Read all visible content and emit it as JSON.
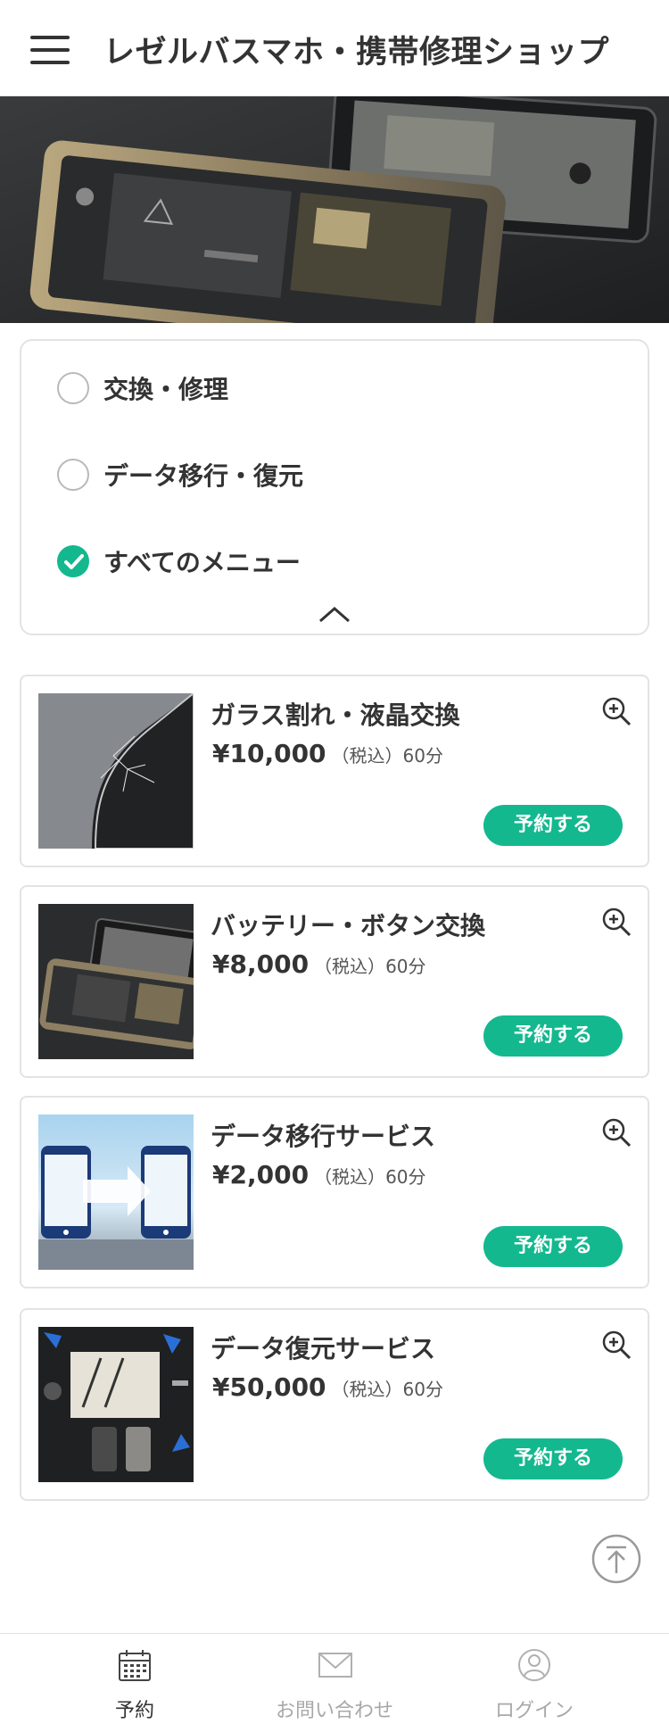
{
  "header": {
    "title": "レゼルバスマホ・携帯修理ショップ",
    "menu_icon": "hamburger-menu-icon"
  },
  "hero": {
    "image": "disassembled-smartphones-photo"
  },
  "filter": {
    "options": [
      {
        "label": "交換・修理",
        "checked": false
      },
      {
        "label": "データ移行・復元",
        "checked": false
      },
      {
        "label": "すべてのメニュー",
        "checked": true
      }
    ],
    "collapse_icon": "chevron-up-icon"
  },
  "menu_items": [
    {
      "title": "ガラス割れ・液晶交換",
      "price": "¥10,000",
      "tax": "（税込）",
      "duration": "60分",
      "button": "予約する",
      "image": "cracked-screen-photo"
    },
    {
      "title": "バッテリー・ボタン交換",
      "price": "¥8,000",
      "tax": "（税込）",
      "duration": "60分",
      "button": "予約する",
      "image": "phone-internals-photo"
    },
    {
      "title": "データ移行サービス",
      "price": "¥2,000",
      "tax": "（税込）",
      "duration": "60分",
      "button": "予約する",
      "image": "data-transfer-illustration"
    },
    {
      "title": "データ復元サービス",
      "price": "¥50,000",
      "tax": "（税込）",
      "duration": "60分",
      "button": "予約する",
      "image": "repair-tools-photo"
    }
  ],
  "bottom_nav": [
    {
      "label": "予約",
      "icon": "calendar-icon",
      "active": true
    },
    {
      "label": "お問い合わせ",
      "icon": "mail-icon",
      "active": false
    },
    {
      "label": "ログイン",
      "icon": "user-icon",
      "active": false
    }
  ],
  "colors": {
    "accent": "#14b88e",
    "text": "#333333",
    "border": "#e3e3e3",
    "inactive": "#a8a8a8"
  }
}
